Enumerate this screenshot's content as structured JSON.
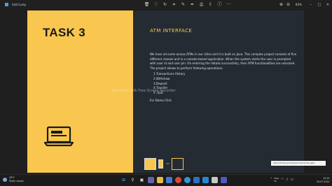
{
  "window": {
    "title": "task3.png",
    "zoom": "83%",
    "toolbar": {
      "zoom_in_glyph": "⊕",
      "zoom_out_glyph": "⊖",
      "more_glyph": "···"
    }
  },
  "slide": {
    "task_title": "TASK 3",
    "heading": "ATM INTERFACE",
    "intro": "We have all come across ATMs in our cities and it is built on Java. This complex project consists of five different classes and is a console-based application. When the system starts the user is prompted with user id and user pin. On entering the details successfully, then ATM functionalities are unlocked. The project allows to perform following operations:",
    "operations": [
      "1.Transactions History",
      "2.Withdraw",
      "3.Deposit",
      "4.Transfer",
      "5. Quit"
    ],
    "link": "For Demo Click",
    "watermark": "Recorded with Free Screen Recorder"
  },
  "thumbnails": {
    "count_label": "2/2"
  },
  "notification": {
    "text": "Click to finish recording  Don't show this again"
  },
  "taskbar": {
    "weather_temp": "28°C",
    "weather_desc": "Partly cloudy",
    "lang_top": "ENG",
    "lang_bottom": "IN",
    "time": "10:19",
    "date": "26-07-2022",
    "apps": [
      "start",
      "search",
      "task-view",
      "chat",
      "explorer",
      "store",
      "chrome",
      "edge",
      "mail",
      "vscode",
      "calendar",
      "teams"
    ]
  },
  "colors": {
    "accent_yellow": "#f9c74f",
    "slide_dark": "#242b33",
    "background": "#1f1f1f"
  }
}
